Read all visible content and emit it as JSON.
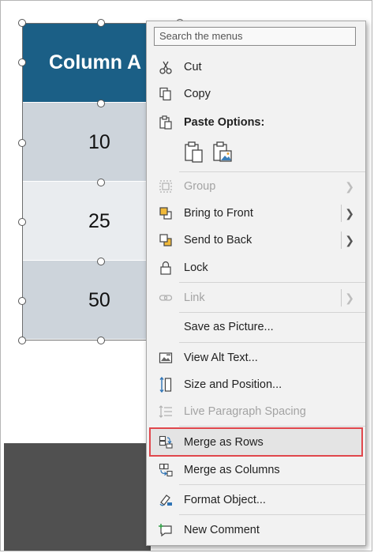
{
  "table": {
    "header": "Column A",
    "rows": [
      "10",
      "25",
      "50"
    ]
  },
  "menu": {
    "search_placeholder": "Search the menus",
    "cut": "Cut",
    "copy": "Copy",
    "paste_options": "Paste Options:",
    "group": "Group",
    "bring_to_front": "Bring to Front",
    "send_to_back": "Send to Back",
    "lock": "Lock",
    "link": "Link",
    "save_as_picture": "Save as Picture...",
    "view_alt_text": "View Alt Text...",
    "size_and_position": "Size and Position...",
    "live_paragraph_spacing": "Live Paragraph Spacing",
    "merge_as_rows": "Merge as Rows",
    "merge_as_columns": "Merge as Columns",
    "format_object": "Format Object...",
    "new_comment": "New Comment"
  },
  "colors": {
    "header_fill": "#1b5f86",
    "row_dark": "#cdd4db",
    "row_light": "#e9ecef",
    "highlight_border": "#e0474c",
    "menu_bg": "#f2f2f2"
  },
  "icons": [
    "scissors-icon",
    "copy-icon",
    "paste-icon",
    "paste-keep-icon",
    "paste-picture-icon",
    "group-icon",
    "bring-front-icon",
    "send-back-icon",
    "lock-icon",
    "link-icon",
    "alt-text-icon",
    "size-position-icon",
    "paragraph-spacing-icon",
    "merge-rows-icon",
    "merge-columns-icon",
    "format-object-icon",
    "new-comment-icon",
    "chevron-right-icon"
  ]
}
